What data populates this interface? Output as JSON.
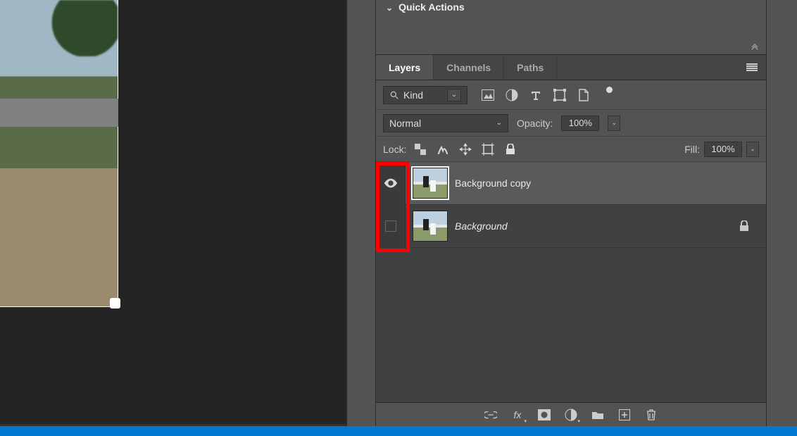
{
  "quick_actions": {
    "title": "Quick Actions"
  },
  "tabs": {
    "layers": "Layers",
    "channels": "Channels",
    "paths": "Paths"
  },
  "filter": {
    "kind_label": "Kind"
  },
  "blend": {
    "mode": "Normal",
    "opacity_label": "Opacity:",
    "opacity_value": "100%"
  },
  "lock": {
    "label": "Lock:",
    "fill_label": "Fill:",
    "fill_value": "100%"
  },
  "layers": [
    {
      "name": "Background copy",
      "visible": true,
      "selected": true,
      "locked": false,
      "italic": false
    },
    {
      "name": "Background",
      "visible": false,
      "selected": false,
      "locked": true,
      "italic": true
    }
  ]
}
